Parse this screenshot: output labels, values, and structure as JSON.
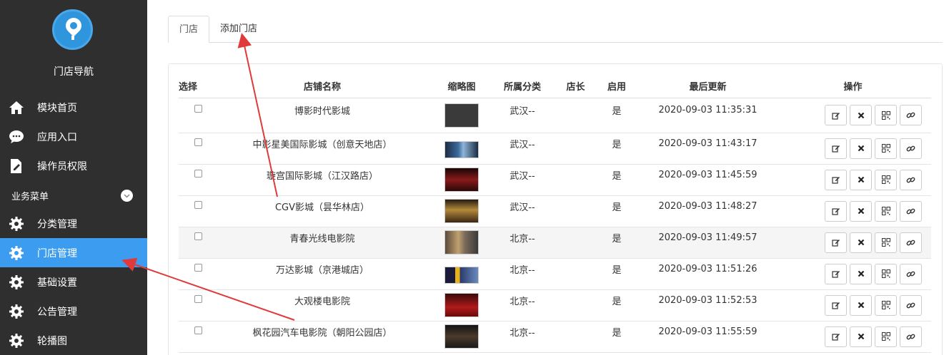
{
  "sidebar": {
    "brand": "门店导航",
    "items": [
      {
        "label": "模块首页"
      },
      {
        "label": "应用入口"
      },
      {
        "label": "操作员权限"
      }
    ],
    "section_title": "业务菜单",
    "section_items": [
      {
        "label": "分类管理"
      },
      {
        "label": "门店管理"
      },
      {
        "label": "基础设置"
      },
      {
        "label": "公告管理"
      },
      {
        "label": "轮播图"
      }
    ],
    "active_color": "#3b9cf0"
  },
  "tabs": [
    {
      "label": "门店"
    },
    {
      "label": "添加门店"
    }
  ],
  "table": {
    "headers": {
      "select": "选择",
      "name": "店铺名称",
      "thumb": "缩略图",
      "category": "所属分类",
      "manager": "店长",
      "enabled": "启用",
      "updated": "最后更新",
      "ops": "操作"
    },
    "rows": [
      {
        "name": "博影时代影城",
        "category": "武汉--",
        "manager": "",
        "enabled": "是",
        "updated": "2020-09-03 11:35:31"
      },
      {
        "name": "中影星美国际影城（创意天地店）",
        "category": "武汉--",
        "manager": "",
        "enabled": "是",
        "updated": "2020-09-03 11:43:17"
      },
      {
        "name": "璇宫国际影城（江汉路店）",
        "category": "武汉--",
        "manager": "",
        "enabled": "是",
        "updated": "2020-09-03 11:45:59"
      },
      {
        "name": "CGV影城（昙华林店）",
        "category": "武汉--",
        "manager": "",
        "enabled": "是",
        "updated": "2020-09-03 11:48:27"
      },
      {
        "name": "青春光线电影院",
        "category": "北京--",
        "manager": "",
        "enabled": "是",
        "updated": "2020-09-03 11:49:57"
      },
      {
        "name": "万达影城（京港城店）",
        "category": "北京--",
        "manager": "",
        "enabled": "是",
        "updated": "2020-09-03 11:51:26"
      },
      {
        "name": "大观楼电影院",
        "category": "北京--",
        "manager": "",
        "enabled": "是",
        "updated": "2020-09-03 11:52:53"
      },
      {
        "name": "枫花园汽车电影院（朝阳公园店）",
        "category": "北京--",
        "manager": "",
        "enabled": "是",
        "updated": "2020-09-03 11:55:59"
      }
    ]
  },
  "annotation_color": "#e03a3a"
}
